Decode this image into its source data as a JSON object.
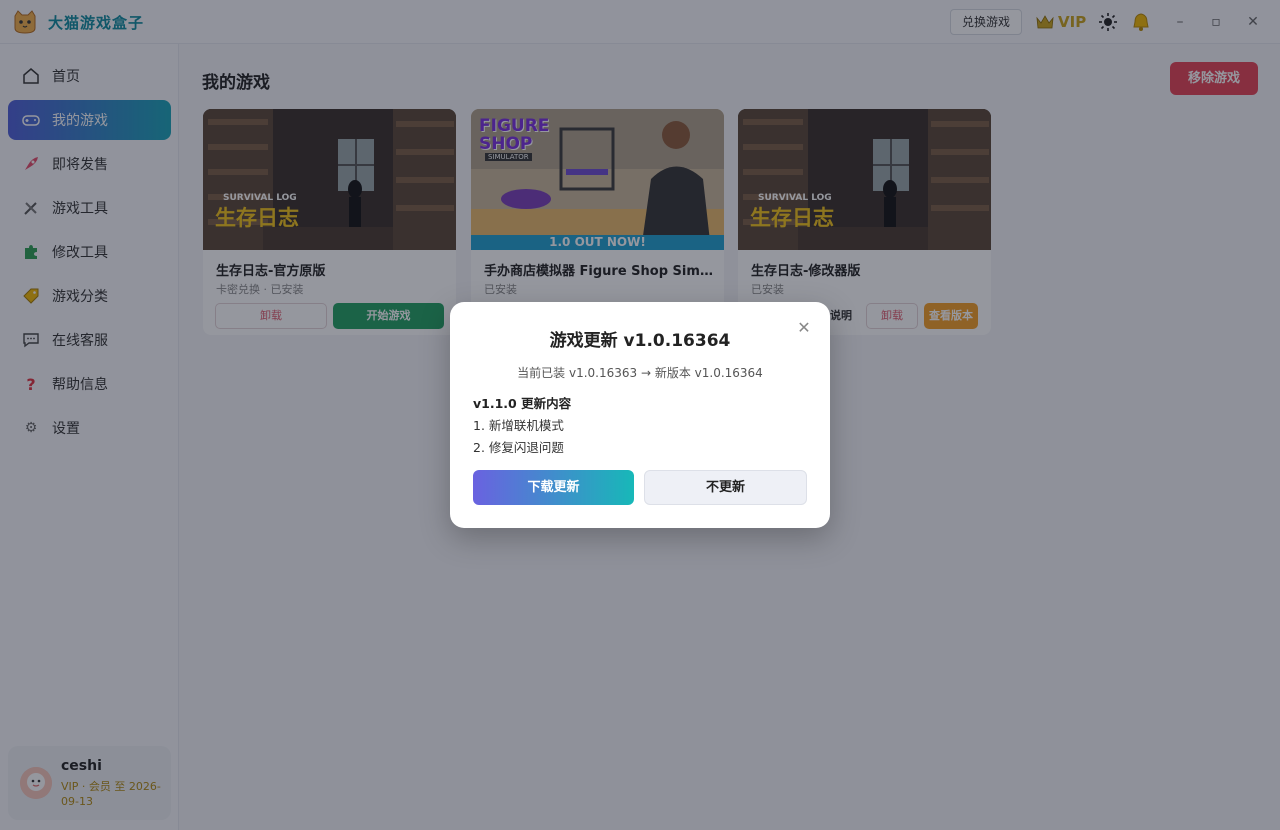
{
  "app": {
    "title": "大猫游戏盒子",
    "redeem_label": "兑换游戏",
    "vip_label": "VIP",
    "icons": [
      "cat-logo-icon",
      "crown-icon",
      "sun-icon",
      "bell-icon",
      "minimize-icon",
      "maximize-icon",
      "close-icon"
    ]
  },
  "sidebar": {
    "items": [
      {
        "label": "首页",
        "icon": "home-icon"
      },
      {
        "label": "我的游戏",
        "icon": "gamepad-icon",
        "active": true
      },
      {
        "label": "即将发售",
        "icon": "rocket-icon"
      },
      {
        "label": "游戏工具",
        "icon": "tools-icon"
      },
      {
        "label": "修改工具",
        "icon": "puzzle-icon"
      },
      {
        "label": "游戏分类",
        "icon": "tag-icon"
      },
      {
        "label": "在线客服",
        "icon": "chat-icon"
      },
      {
        "label": "帮助信息",
        "icon": "question-icon"
      },
      {
        "label": "设置",
        "icon": "gear-icon"
      }
    ],
    "user": {
      "name": "ceshi",
      "vip_text": "VIP · 会员 至 2026-09-13"
    }
  },
  "main": {
    "title": "我的游戏",
    "migrate_label": "移除游戏",
    "cards": [
      {
        "name": "生存日志-官方原版",
        "status": "卡密兑换 · 已安装",
        "cover_title": "生存日志",
        "cover_sub": "SURVIVAL LOG",
        "remove": "卸载",
        "start": "开始游戏"
      },
      {
        "name": "手办商店模拟器 Figure Shop Simulator",
        "status": "已安装",
        "cover_title": "FIGURE SHOP",
        "cover_sub": "SIMULATOR",
        "cover_banner": "1.0 OUT NOW!"
      },
      {
        "name": "生存日志-修改器版",
        "status": "已安装",
        "cover_title": "生存日志",
        "cover_sub": "SURVIVAL LOG",
        "guide": "说明",
        "remove": "卸载",
        "version": "查看版本"
      }
    ]
  },
  "modal": {
    "title": "游戏更新 v1.0.16364",
    "subtitle": "当前已装 v1.0.16363 → 新版本 v1.0.16364",
    "notes_title": "v1.1.0 更新内容",
    "notes": [
      "1. 新增联机模式",
      "2. 修复闪退问题"
    ],
    "download_label": "下载更新",
    "skip_label": "不更新",
    "close_symbol": "✕"
  },
  "colors": {
    "accent": "#0f8a9e",
    "active_nav_start": "#4f5fd8",
    "active_nav_end": "#1aa4b8",
    "danger": "#e64255",
    "success": "#22a062",
    "warning": "#f59e26",
    "vip_gold": "#c9a21a"
  }
}
